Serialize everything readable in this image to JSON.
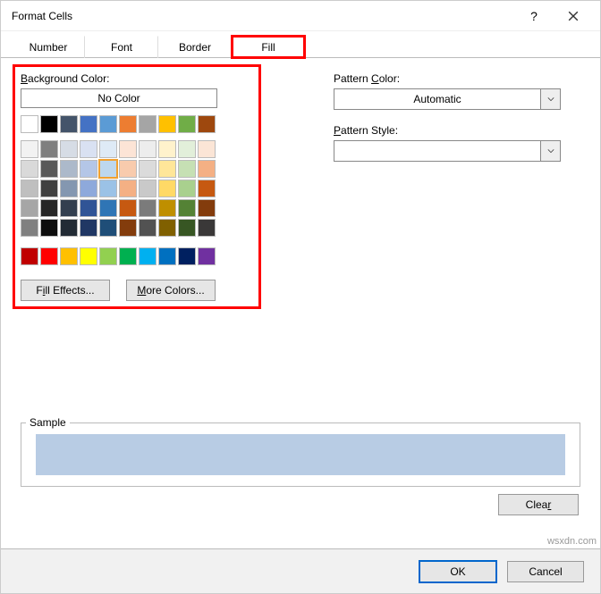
{
  "window": {
    "title": "Format Cells"
  },
  "tabs": {
    "items": [
      {
        "label": "Number",
        "active": false
      },
      {
        "label": "Font",
        "active": false
      },
      {
        "label": "Border",
        "active": false
      },
      {
        "label": "Fill",
        "active": true
      }
    ]
  },
  "fill": {
    "background_color_label": "Background Color:",
    "no_color_label": "No Color",
    "theme_colors_row1": [
      "#ffffff",
      "#000000",
      "#44546a",
      "#4472c4",
      "#5b9bd5",
      "#ed7d31",
      "#a5a5a5",
      "#ffc000",
      "#70ad47",
      "#9e480e"
    ],
    "theme_colors_grid": [
      [
        "#f2f2f2",
        "#7f7f7f",
        "#d6dce5",
        "#d9e1f2",
        "#deeaf6",
        "#fce4d6",
        "#ededed",
        "#fff2cc",
        "#e2efda",
        "#fbe5d6"
      ],
      [
        "#d9d9d9",
        "#595959",
        "#acb9ca",
        "#b4c6e7",
        "#bdd7ee",
        "#f8cbad",
        "#dbdbdb",
        "#ffe699",
        "#c6e0b4",
        "#f4b084"
      ],
      [
        "#bfbfbf",
        "#404040",
        "#8497b0",
        "#8ea9db",
        "#9bc2e6",
        "#f4b084",
        "#c9c9c9",
        "#ffd966",
        "#a9d08e",
        "#c65911"
      ],
      [
        "#a6a6a6",
        "#262626",
        "#333f4f",
        "#305496",
        "#2f75b5",
        "#c65911",
        "#7b7b7b",
        "#bf8f00",
        "#548235",
        "#833c0c"
      ],
      [
        "#808080",
        "#0d0d0d",
        "#222b35",
        "#203764",
        "#1f4e78",
        "#833c0c",
        "#525252",
        "#806000",
        "#375623",
        "#3a3838"
      ]
    ],
    "standard_colors": [
      "#c00000",
      "#ff0000",
      "#ffc000",
      "#ffff00",
      "#92d050",
      "#00b050",
      "#00b0f0",
      "#0070c0",
      "#002060",
      "#7030a0"
    ],
    "selected_color": "#bdd7ee",
    "fill_effects_label": "Fill Effects...",
    "more_colors_label": "More Colors..."
  },
  "pattern": {
    "color_label": "Pattern Color:",
    "color_value": "Automatic",
    "style_label": "Pattern Style:",
    "style_value": ""
  },
  "sample": {
    "label": "Sample",
    "color": "#b8cce4"
  },
  "clear_label": "Clear",
  "footer": {
    "ok": "OK",
    "cancel": "Cancel"
  },
  "watermark": "wsxdn.com"
}
